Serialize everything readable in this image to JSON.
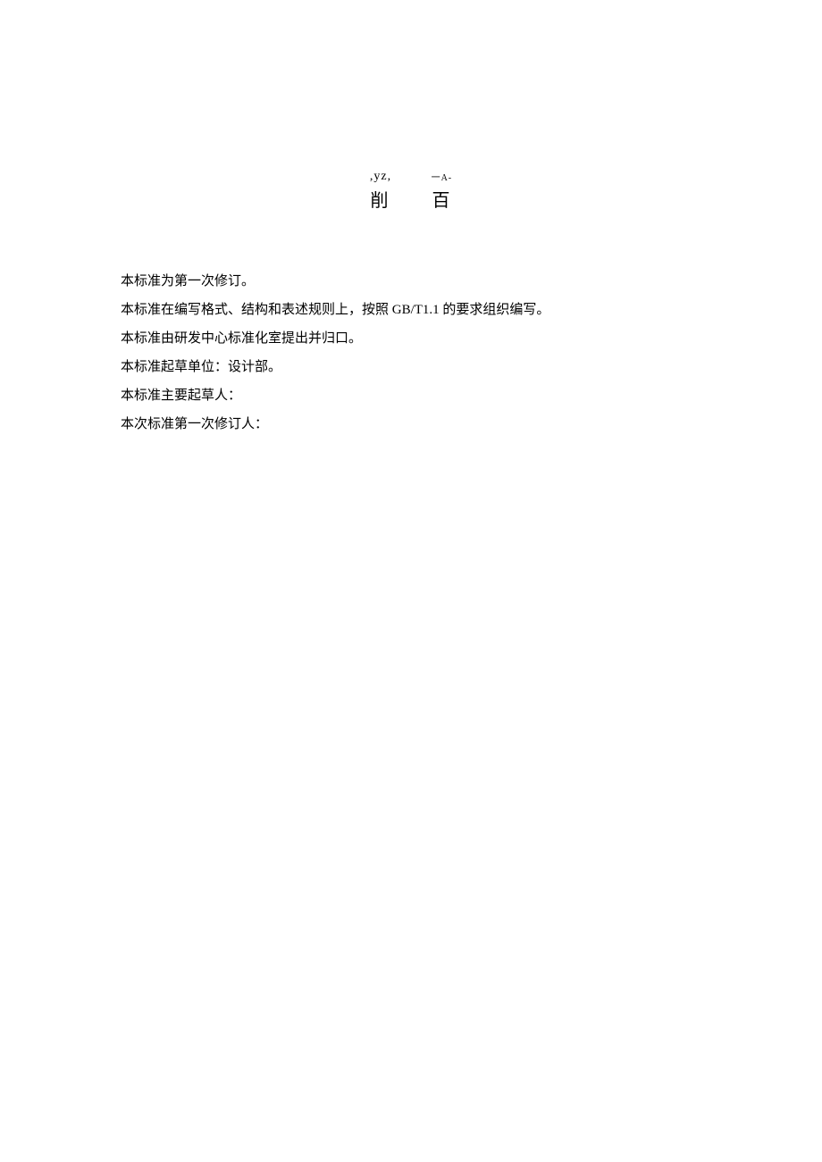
{
  "header": {
    "line1_part1": ",yz,",
    "line1_part2": "一A-",
    "line2_char1": "削",
    "line2_char2": "百"
  },
  "paragraphs": [
    "本标准为第一次修订。",
    "本标准在编写格式、结构和表述规则上，按照 GB/T1.1 的要求组织编写。",
    "本标准由研发中心标准化室提出并归口。",
    "本标准起草单位：设计部。",
    "本标准主要起草人：",
    "本次标准第一次修订人："
  ]
}
